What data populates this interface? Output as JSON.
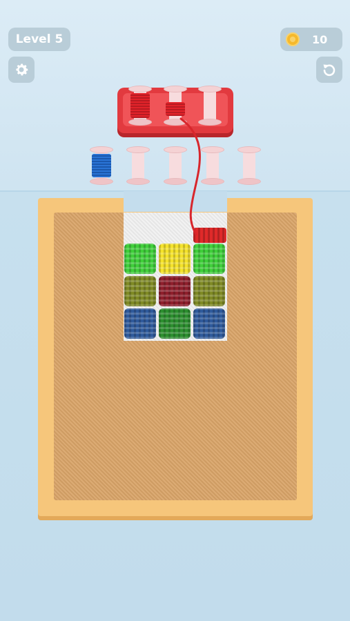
{
  "hud": {
    "level_label": "Level 5",
    "coins": "10",
    "settings_icon": "gear-icon",
    "restart_icon": "restart-icon",
    "coin_icon": "coin-icon"
  },
  "colors": {
    "tray": "#e23a3f",
    "board": "#f6c67b",
    "fabric": "#d9a468"
  },
  "tray_spools": [
    {
      "thread": "red",
      "fill": 1.0
    },
    {
      "thread": "red",
      "fill": 0.6
    },
    {
      "thread": "empty",
      "fill": 0
    }
  ],
  "queue_spools": [
    {
      "thread": "blue",
      "fill": 1.0
    },
    {
      "thread": "empty",
      "fill": 0
    },
    {
      "thread": "empty",
      "fill": 0
    },
    {
      "thread": "empty",
      "fill": 0
    },
    {
      "thread": "empty",
      "fill": 0
    }
  ],
  "pattern": {
    "rows": [
      [
        "#3fcf3a",
        "#f4e22a",
        "#3fcf3a"
      ],
      [
        "#7f8a25",
        "#8f1f2c",
        "#7f8a25"
      ],
      [
        "#2f5a9c",
        "#2c8f2f",
        "#2f5a9c"
      ]
    ]
  }
}
